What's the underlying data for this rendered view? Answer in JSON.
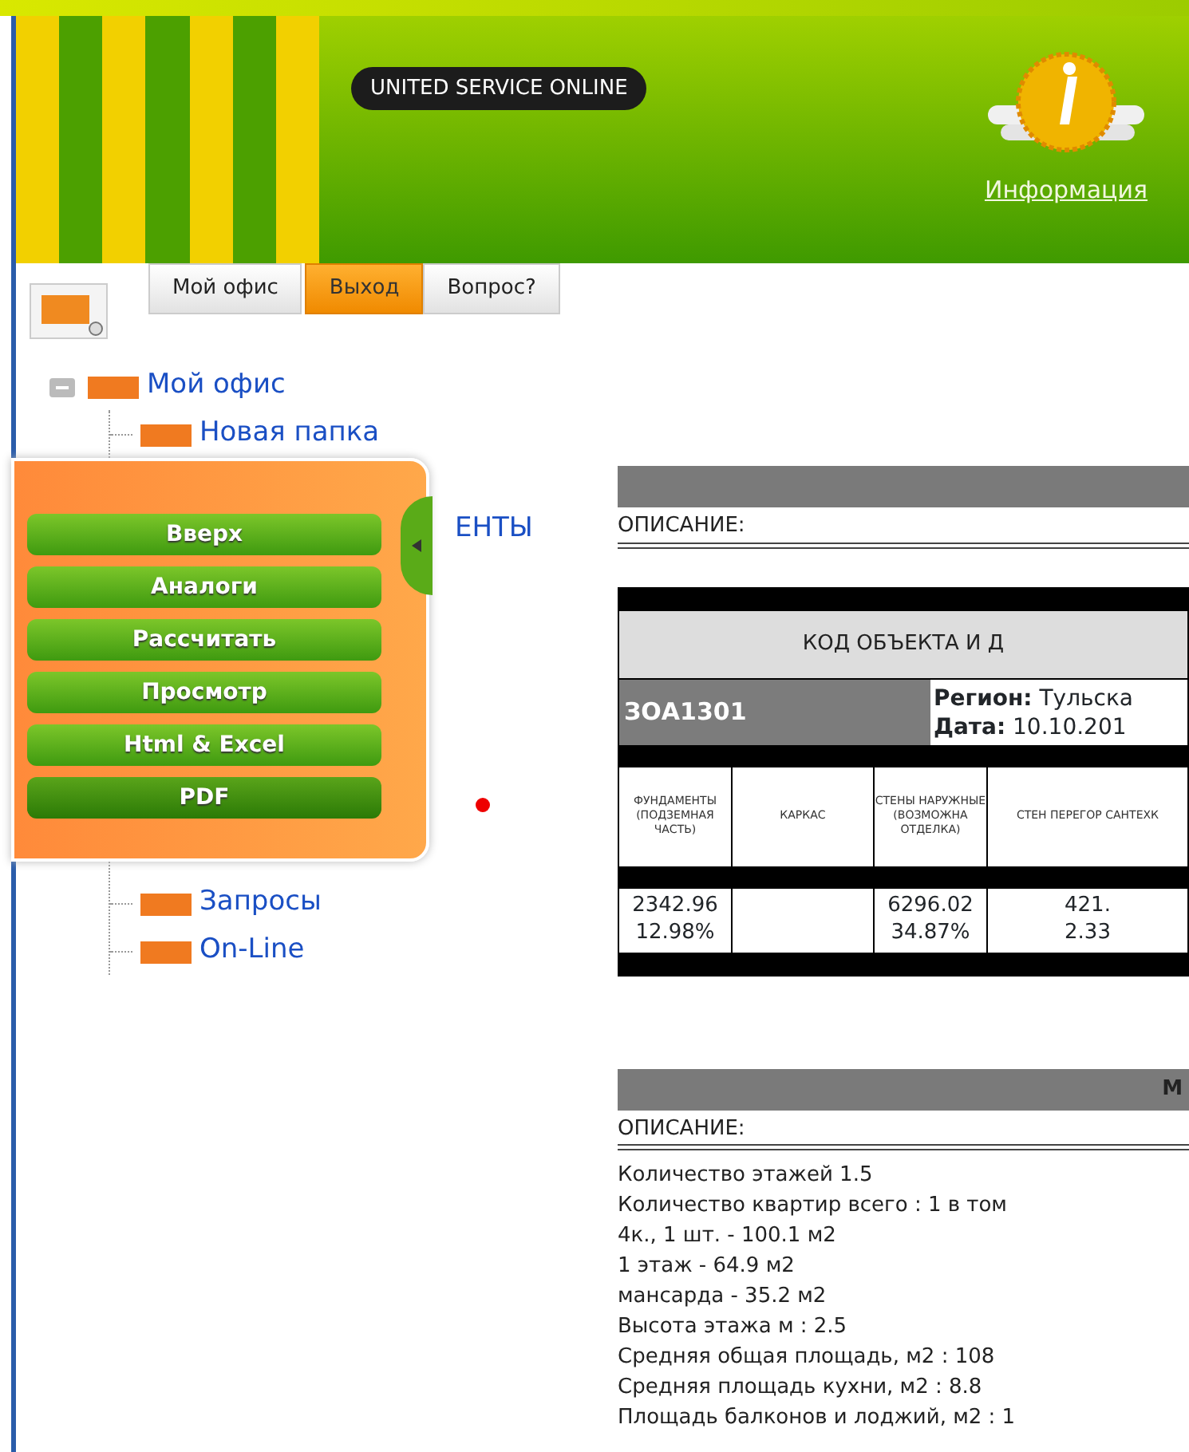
{
  "header": {
    "logo": "UNITED SERVICE ONLINE",
    "info_link": "Информация"
  },
  "tabs": [
    {
      "label": "Мой офис",
      "selected": false
    },
    {
      "label": "Выход",
      "selected": true
    },
    {
      "label": "Вопрос?",
      "selected": false
    }
  ],
  "tree": {
    "label": "Мой офис",
    "expanded": true,
    "children": [
      {
        "label": "Новая папка",
        "covered": false
      },
      {
        "label": "ЕНТЫ",
        "covered": true
      },
      {
        "label": "Запросы",
        "covered": false
      },
      {
        "label": "On-Line",
        "covered": false
      }
    ]
  },
  "action_panel": {
    "buttons": [
      {
        "label": "Вверх",
        "selected": false
      },
      {
        "label": "Аналоги",
        "selected": false
      },
      {
        "label": "Рассчитать",
        "selected": false
      },
      {
        "label": "Просмотр",
        "selected": false
      },
      {
        "label": "Html & Excel",
        "selected": false
      },
      {
        "label": "PDF",
        "selected": true
      }
    ]
  },
  "section_1": {
    "description_label": "ОПИСАНИЕ:",
    "table": {
      "caption": "КОД ОБЪЕКТА И Д",
      "code": "ЗОА1301",
      "region": "**Регион:** Тульска",
      "date": "**Дата:** 10.10.201",
      "columns": [
        {
          "header": "ФУНДАМЕНТЫ (ПОДЗЕМНАЯ ЧАСТЬ)",
          "values": [
            "2342.96",
            "12.98%"
          ]
        },
        {
          "header": "КАРКАС"
        },
        {
          "header": "СТЕНЫ НАРУЖНЫЕ (ВОЗМОЖНА ОТДЕЛКА)",
          "values": [
            "6296.02",
            "34.87%"
          ]
        },
        {
          "header": "СТЕН ПЕРЕГОР САНТЕХК",
          "values": [
            "421.",
            "2.33"
          ]
        }
      ]
    }
  },
  "section_2": {
    "title": "М",
    "description_label": "ОПИСАНИЕ:",
    "lines": [
      "Количество этажей 1.5",
      "Количество квартир всего : 1 в том",
      "4к., 1 шт. - 100.1 м2",
      "1 этаж - 64.9 м2",
      "мансарда - 35.2 м2",
      "Высота этажа м : 2.5",
      "Средняя общая площадь, м2 : 108",
      "Средняя площадь кухни, м2 : 8.8",
      "Площадь балконов и лоджий, м2 : 1"
    ]
  }
}
